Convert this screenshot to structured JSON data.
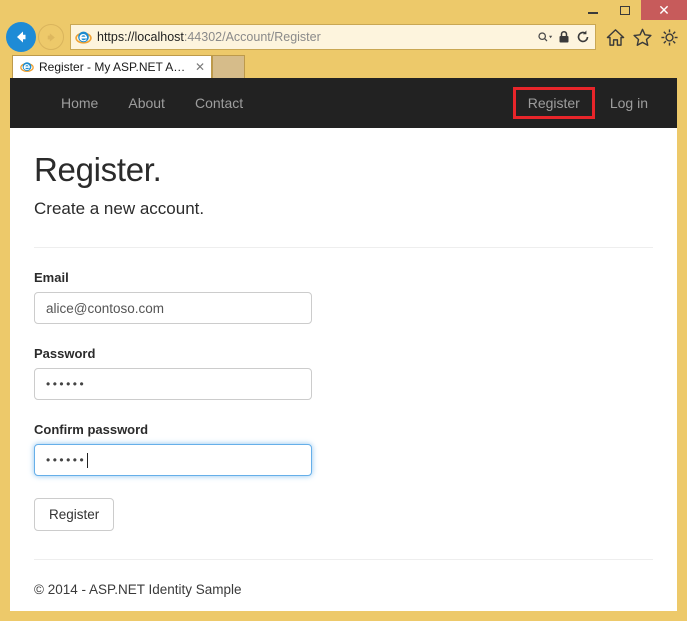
{
  "browser": {
    "window_controls": {
      "minimize": "—",
      "maximize": "▢",
      "close": "✕"
    },
    "back_tooltip": "Back",
    "forward_tooltip": "Forward",
    "url": {
      "scheme": "https://",
      "host": "localhost",
      "port": ":44302",
      "path": "/Account/Register",
      "full": "https://localhost:44302/Account/Register",
      "path_highlight_color": "#E8252A"
    },
    "address_icons": [
      "search-icon",
      "dropdown-arrow-icon",
      "lock-icon",
      "refresh-icon"
    ],
    "chrome_icons": [
      "home-icon",
      "favorites-star-icon",
      "settings-gear-icon"
    ],
    "tab": {
      "title": "Register - My ASP.NET App...",
      "close_label": "✕"
    },
    "chrome_color": "#EDC96A",
    "close_button_color": "#C75B5B"
  },
  "site_nav": {
    "left_links": [
      {
        "label": "Home"
      },
      {
        "label": "About"
      },
      {
        "label": "Contact"
      }
    ],
    "right_links": [
      {
        "label": "Register",
        "highlighted": true
      },
      {
        "label": "Log in",
        "highlighted": false
      }
    ],
    "background": "#222222",
    "link_color": "#9D9D9D",
    "highlight_color": "#E8252A"
  },
  "page": {
    "heading": "Register.",
    "subheading": "Create a new account.",
    "form": {
      "fields": [
        {
          "name": "email",
          "label": "Email",
          "value": "alice@contoso.com",
          "type": "text",
          "focused": false
        },
        {
          "name": "password",
          "label": "Password",
          "value": "••••••",
          "type": "password",
          "focused": false
        },
        {
          "name": "confirm_password",
          "label": "Confirm password",
          "value": "••••••",
          "type": "password",
          "focused": true
        }
      ],
      "submit_label": "Register"
    },
    "footer": "© 2014 - ASP.NET Identity Sample",
    "focus_border_color": "#66AFE9"
  }
}
